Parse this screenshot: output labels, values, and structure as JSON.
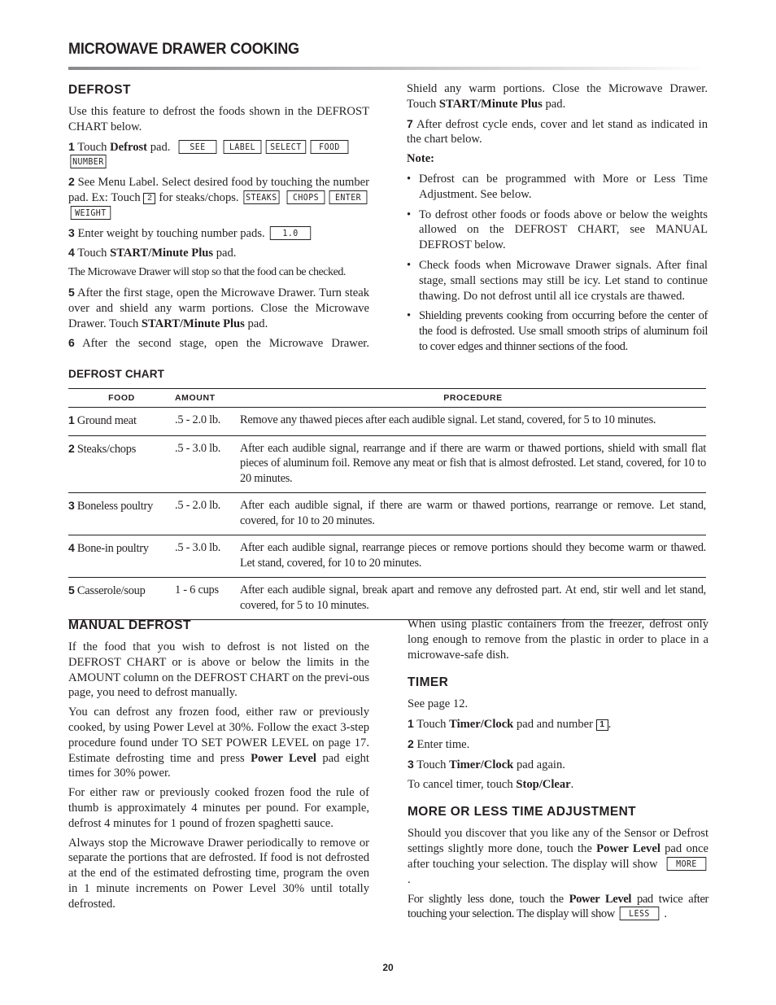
{
  "page": {
    "title": "MICROWAVE DRAWER COOKING",
    "page_number": "20"
  },
  "defrost": {
    "heading": "DEFROST",
    "intro": "Use this feature to defrost the foods shown in the DEFROST CHART below.",
    "step1": {
      "num": "1",
      "pre": "Touch ",
      "bold": "Defrost",
      "post": " pad.",
      "display": [
        "SEE",
        "LABEL",
        "SELECT",
        "FOOD",
        "NUMBER"
      ]
    },
    "step2": {
      "num": "2",
      "pre": "See Menu Label. Select desired food by touching the number pad. Ex: Touch ",
      "key": "2",
      "post": " for steaks/chops.",
      "display": [
        "STEAKS",
        "CHOPS",
        "ENTER",
        "WEIGHT"
      ]
    },
    "step3": {
      "num": "3",
      "text": "Enter weight by touching number pads.",
      "display": "1.0"
    },
    "step4": {
      "num": "4",
      "pre": "Touch ",
      "bold": "START/Minute Plus",
      "post": " pad."
    },
    "stop_note": "The Microwave Drawer will stop so that the food can be checked.",
    "step5": {
      "num": "5",
      "pre": "After the first stage, open the Microwave Drawer. Turn steak over and shield any warm portions. Close the Microwave Drawer. Touch ",
      "bold": "START/Minute Plus",
      "post": " pad."
    },
    "step6": {
      "num": "6",
      "pre": "After the second stage, open the Microwave Drawer. Shield any warm portions. Close the Microwave Drawer. Touch ",
      "bold": "START/Minute Plus",
      "post": " pad."
    },
    "step7": {
      "num": "7",
      "text": "After defrost cycle ends, cover and let stand as indicated in the chart below."
    },
    "note_label": "Note:",
    "notes": [
      "Defrost can be programmed with More or Less Time Adjustment. See below.",
      "To defrost other foods or foods above or below the weights allowed on the DEFROST CHART, see MANUAL DEFROST below.",
      "Check foods when Microwave Drawer signals. After final stage, small sections may still be icy. Let stand to continue thawing. Do not defrost until all ice crystals are thawed.",
      "Shielding prevents cooking from occurring before the center of the food is defrosted. Use small smooth strips of aluminum foil to cover edges and thinner sections of the food."
    ]
  },
  "defrost_chart": {
    "title": "DEFROST CHART",
    "headers": [
      "FOOD",
      "AMOUNT",
      "PROCEDURE"
    ],
    "rows": [
      {
        "num": "1",
        "food": "Ground meat",
        "amount": ".5 - 2.0 lb.",
        "procedure": "Remove any thawed pieces after each audible signal. Let stand, covered, for 5 to 10 minutes."
      },
      {
        "num": "2",
        "food": "Steaks/chops",
        "amount": ".5 - 3.0 lb.",
        "procedure": "After each audible signal, rearrange and if there are warm or thawed portions, shield with small flat pieces of aluminum foil. Remove any meat or fish that is almost defrosted. Let stand, covered, for 10 to 20 minutes."
      },
      {
        "num": "3",
        "food": "Boneless poultry",
        "amount": ".5 - 2.0 lb.",
        "procedure": "After each audible signal, if there are warm or thawed portions, rearrange or remove.  Let stand, covered, for 10 to 20 minutes."
      },
      {
        "num": "4",
        "food": "Bone-in poultry",
        "amount": ".5 - 3.0 lb.",
        "procedure": "After each audible signal, rearrange pieces or remove portions should they become warm or thawed. Let stand, covered, for 10 to 20 minutes."
      },
      {
        "num": "5",
        "food": "Casserole/soup",
        "amount": "1 - 6 cups",
        "procedure": "After each audible signal, break apart and remove any defrosted part. At end, stir well and let stand, covered, for 5 to 10 minutes."
      }
    ]
  },
  "manual_defrost": {
    "heading": "MANUAL DEFROST",
    "p1": "If the food that you wish to defrost is not listed on the DEFROST CHART or is above or below the limits in the AMOUNT column on the DEFROST CHART on the previ-ous page, you need to defrost manually.",
    "p2_pre": "You can defrost any frozen food, either raw or previously cooked, by using Power Level at 30%. Follow the exact 3-step procedure found under TO SET POWER LEVEL on page 17. Estimate defrosting time and press ",
    "p2_bold": "Power Level",
    "p2_post": " pad eight times for 30% power.",
    "p3": "For either raw or previously cooked frozen food the rule of thumb is approximately 4 minutes per pound. For example, defrost 4 minutes for 1 pound of frozen spaghetti sauce.",
    "p4": "Always stop the Microwave Drawer periodically to remove or separate the portions that are defrosted. If food is not defrosted at the  end of the estimated defrosting time, program the oven in 1 minute increments on Power Level 30% until totally defrosted.",
    "p5": "When using plastic containers from the freezer, defrost only long enough to remove from the plastic in order to place in a microwave-safe dish."
  },
  "timer": {
    "heading": "TIMER",
    "see_page": "See page 12.",
    "step1": {
      "num": "1",
      "pre": "Touch ",
      "bold": "Timer/Clock",
      "mid": " pad and number ",
      "key": "1",
      "post": "."
    },
    "step2": {
      "num": "2",
      "text": "Enter time."
    },
    "step3": {
      "num": "3",
      "pre": "Touch ",
      "bold": "Timer/Clock",
      "post": " pad again."
    },
    "cancel_pre": "To cancel timer, touch ",
    "cancel_bold": "Stop/Clear",
    "cancel_post": "."
  },
  "time_adjustment": {
    "heading": "MORE OR LESS TIME ADJUSTMENT",
    "p1_pre": "Should you discover that you like any of the Sensor or Defrost settings slightly more done, touch the ",
    "p1_bold": "Power Level",
    "p1_post": " pad once after touching your selection. The display will show",
    "p1_display": "MORE",
    "p2_pre": "For slightly less done, touch the ",
    "p2_bold": "Power Level",
    "p2_post": " pad twice after touching your selection. The display will show",
    "p2_display": "LESS"
  }
}
